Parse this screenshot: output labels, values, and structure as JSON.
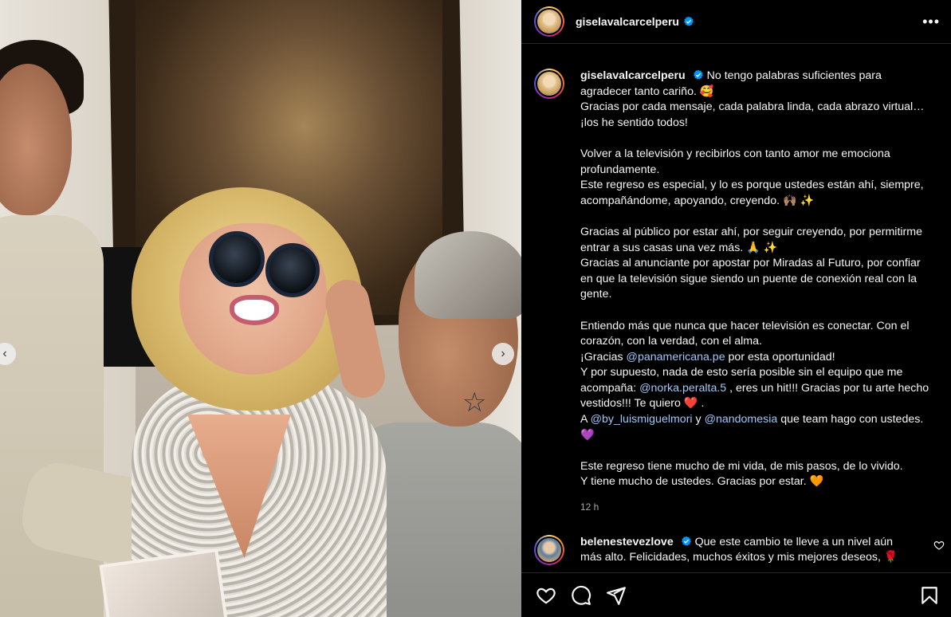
{
  "post": {
    "username": "giselavalcarcelperu",
    "verified": true,
    "caption_paragraphs": [
      [
        "No tengo palabras suficientes para agradecer tanto cariño. 🥰"
      ],
      [
        "Gracias por cada mensaje, cada palabra linda, cada abrazo virtual… ¡los he sentido todos!"
      ],
      [],
      [
        "Volver a la televisión y recibirlos con tanto amor me emociona profundamente."
      ],
      [
        "Este regreso es especial, y lo es porque ustedes están ahí, siempre, acompañándome, apoyando, creyendo. 🙌🏽 ✨"
      ],
      [],
      [
        "Gracias al público por estar ahí, por seguir creyendo, por permitirme entrar a sus casas una vez más. 🙏 ✨"
      ],
      [
        "Gracias al anunciante por apostar por Miradas al Futuro, por confiar en que la televisión sigue siendo un puente de conexión real con la gente."
      ],
      [],
      [
        "Entiendo más que nunca que hacer televisión es conectar. Con el corazón, con la verdad, con el alma."
      ]
    ],
    "line_gracias_pre": "¡Gracias ",
    "mention_panamericana": "@panamericana.pe",
    "line_gracias_post": " por esta oportunidad!",
    "line_equipo_pre": "Y por supuesto, nada de esto sería posible sin el equipo que me acompaña: ",
    "mention_norka": "@norka.peralta.5",
    "line_equipo_post": " , eres un hit!!! Gracias por tu arte hecho vestidos!!! Te quiero ❤️ .",
    "line_team_pre": "A ",
    "mention_luismiguel": "@by_luismiguelmori",
    "line_team_mid": " y ",
    "mention_nandomesia": "@nandomesia",
    "line_team_post": " que team hago con ustedes. 💜",
    "closing_1": "Este regreso tiene mucho de mi vida, de mis pasos, de lo vivido.",
    "closing_2": "Y tiene mucho de ustedes. Gracias por estar. 🧡",
    "timestamp": "12 h"
  },
  "comment": {
    "username": "belenestevezlove",
    "verified": true,
    "text": "Que este cambio te lleve a un nivel aún más alto. Felicidades, muchos éxitos y mis mejores deseos, 🌹"
  },
  "icons": {
    "header_more": "more-horizontal-icon",
    "like": "heart-icon",
    "comment": "comment-icon",
    "share": "share-icon",
    "save": "bookmark-icon",
    "nav_prev": "chevron-left-icon",
    "nav_next": "chevron-right-icon"
  },
  "colors": {
    "background": "#000000",
    "text": "#f5f5f5",
    "mention": "#9fc7f8",
    "muted": "#a8a8a8",
    "verified": "#0095f6"
  }
}
